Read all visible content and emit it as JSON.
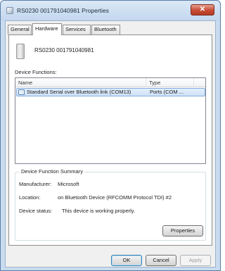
{
  "window": {
    "title": "RS0230 001791040981 Properties",
    "close_glyph": "✕"
  },
  "tabs": [
    {
      "label": "General"
    },
    {
      "label": "Hardware",
      "active": true
    },
    {
      "label": "Services"
    },
    {
      "label": "Bluetooth"
    }
  ],
  "device": {
    "name": "RS0230 001791040981",
    "icon": "device-icon"
  },
  "functions": {
    "label": "Device Functions:",
    "columns": [
      "Name",
      "Type"
    ],
    "rows": [
      {
        "name": "Standard Serial over Bluetooth link (COM13)",
        "type": "Ports (COM ..."
      }
    ]
  },
  "summary": {
    "legend": "Device Function Summary",
    "manufacturer_label": "Manufacturer:",
    "manufacturer_value": "Microsoft",
    "location_label": "Location:",
    "location_value": "on Bluetooth Device (RFCOMM Protocol TDI) #2",
    "status_label": "Device status:",
    "status_value": "This device is working properly.",
    "properties_button": "Properties"
  },
  "buttons": {
    "ok": "OK",
    "cancel": "Cancel",
    "apply": "Apply"
  },
  "colors": {
    "selection": "#cfe2f9",
    "close_button": "#c74b35",
    "titlebar": "#c9dcef"
  }
}
